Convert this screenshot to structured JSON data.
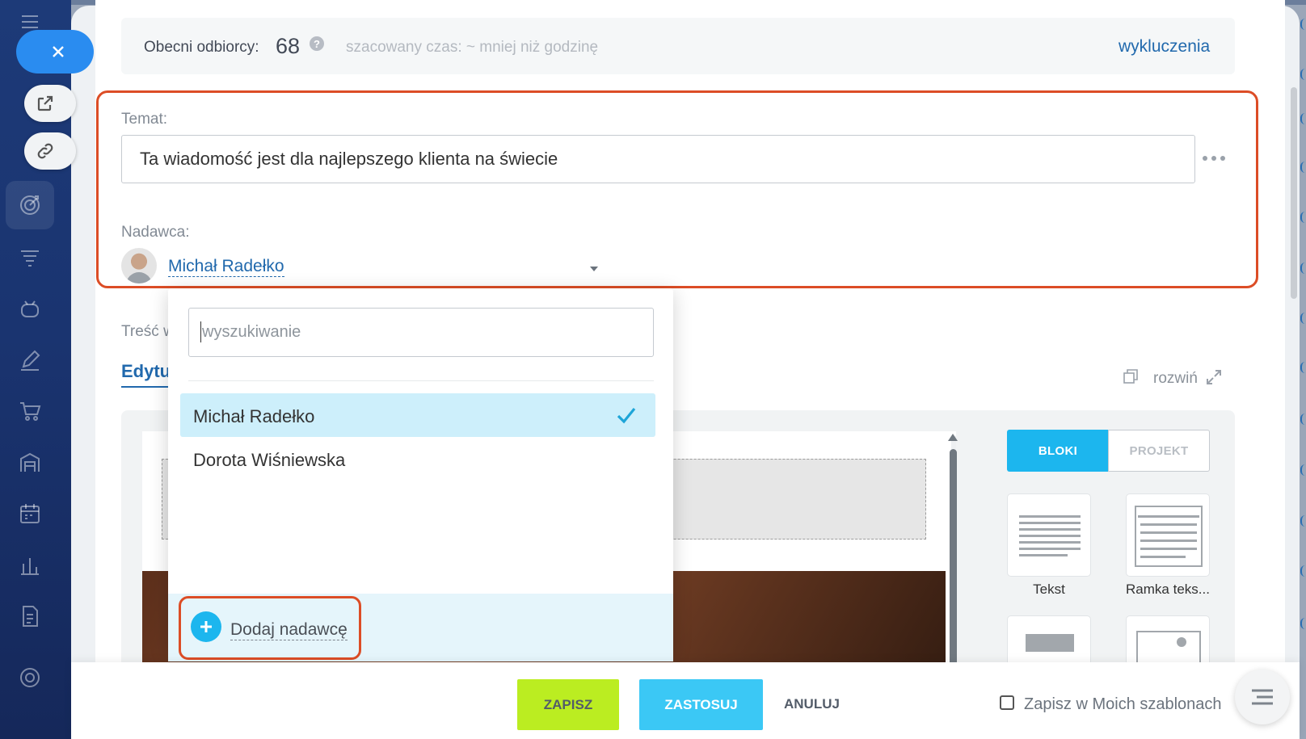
{
  "recipients": {
    "label": "Obecni odbiorcy:",
    "count": "68",
    "help": "?",
    "estimate": "szacowany czas: ~ mniej niż godzinę",
    "exclusions_link": "wykluczenia"
  },
  "subject": {
    "label": "Temat:",
    "value": "Ta wiadomość jest dla najlepszego klienta na świecie"
  },
  "sender": {
    "label": "Nadawca:",
    "name": "Michał Radełko"
  },
  "content": {
    "label": "Treść w",
    "editor_tab": "Edytu",
    "expand_label": "rozwiń"
  },
  "dropdown": {
    "search_placeholder": "wyszukiwanie",
    "options": [
      {
        "label": "Michał Radełko",
        "selected": true
      },
      {
        "label": "Dorota Wiśniewska",
        "selected": false
      }
    ],
    "add_sender": "Dodaj nadawcę"
  },
  "blocks_panel": {
    "tab_blocks": "BLOKI",
    "tab_design": "PROJEKT",
    "tiles": [
      {
        "label": "Tekst",
        "icon": "text-block-icon"
      },
      {
        "label": "Ramka teks...",
        "icon": "text-frame-block-icon"
      }
    ]
  },
  "footer": {
    "save": "ZAPISZ",
    "apply": "ZASTOSUJ",
    "cancel": "ANULUJ",
    "save_template": "Zapisz w Moich szablonach"
  },
  "colors": {
    "accent_blue": "#1cb6ee",
    "link_blue": "#2169ad",
    "highlight_red": "#dc4d26",
    "save_green": "#bbed21",
    "nav_dark": "#1d3a78"
  }
}
